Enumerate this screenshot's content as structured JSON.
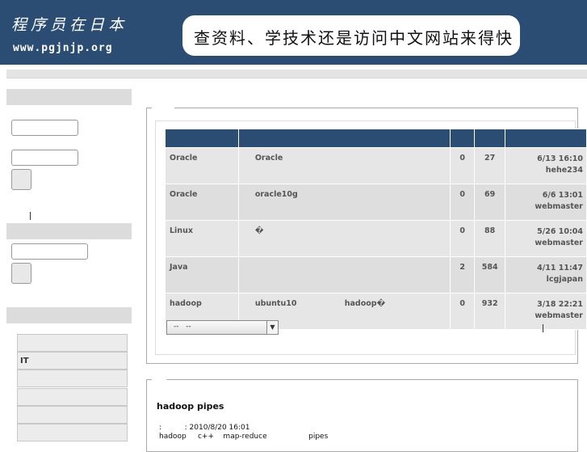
{
  "header": {
    "logo_cn": "程序员在日本",
    "logo_url": "www.pgjnjp.org",
    "banner": "查资料、学技术还是访问中文网站来得快"
  },
  "sidebar": {
    "menu_items": [
      "",
      "IT",
      "",
      "",
      "",
      ""
    ]
  },
  "topics": {
    "rows": [
      {
        "category": "Oracle",
        "subject": "Oracle",
        "replies": "0",
        "views": "27",
        "time": "6/13 16:10",
        "user": "hehe234"
      },
      {
        "category": "Oracle",
        "subject": "oracle10g",
        "replies": "0",
        "views": "69",
        "time": "6/6 13:01",
        "user": "webmaster"
      },
      {
        "category": "Linux",
        "subject": "�",
        "replies": "0",
        "views": "88",
        "time": "5/26 10:04",
        "user": "webmaster"
      },
      {
        "category": "Java",
        "subject": "",
        "replies": "2",
        "views": "584",
        "time": "4/11 11:47",
        "user": "lcgjapan"
      },
      {
        "category": "hadoop",
        "subject": "ubuntu10 hadoop�",
        "replies": "0",
        "views": "932",
        "time": "3/18 22:21",
        "user": "webmaster"
      }
    ],
    "select_value": "--   --"
  },
  "article": {
    "title": "hadoop  pipes",
    "meta": ":          : 2010/8/20 16:01",
    "line": "hadoop     c++    map-reduce                  pipes"
  },
  "colors": {
    "header_bg": "#2b4c73",
    "row_bg": "#e6e6e6",
    "sidebar_bar": "#dcdcdc"
  }
}
